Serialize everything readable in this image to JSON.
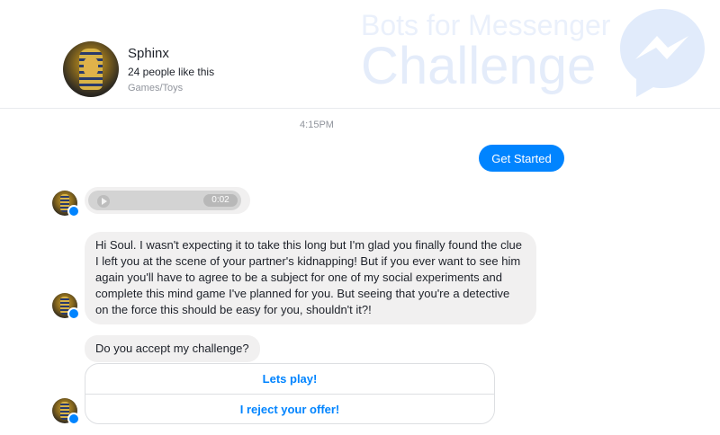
{
  "header": {
    "page_name": "Sphinx",
    "likes": "24 people like this",
    "category": "Games/Toys",
    "watermark_line1": "Bots for Messenger",
    "watermark_line2": "Challenge"
  },
  "conversation": {
    "timestamp": "4:15PM",
    "user_message": "Get Started",
    "audio": {
      "duration": "0:02"
    },
    "bot_message_1": "Hi Soul. I wasn't expecting it to take this long but I'm glad you finally found the clue I left you at the scene of your partner's kidnapping! But if you ever want to see him again you'll have to agree to be a subject for one of my social experiments and complete this mind game I've planned for you. But seeing that you're a detective on the force this should be easy for you, shouldn't it?!",
    "bot_message_2": "Do you accept my challenge?",
    "quick_replies": [
      "Lets play!",
      "I reject your offer!"
    ]
  },
  "colors": {
    "accent": "#0084ff",
    "bubble": "#f1f0f0",
    "muted_text": "#90949c"
  }
}
